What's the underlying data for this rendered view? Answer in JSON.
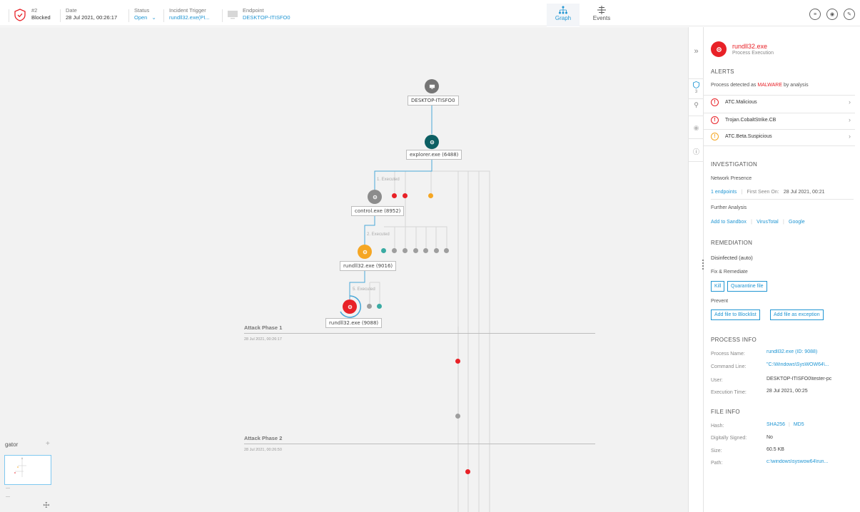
{
  "topbar": {
    "incident_no": "#2",
    "incident_status": "Blocked",
    "date_label": "Date",
    "date_value": "28 Jul 2021, 00:26:17",
    "status_label": "Status",
    "status_value": "Open",
    "trigger_label": "Incident Trigger",
    "trigger_value": "rundll32.exe(PI...",
    "endpoint_label": "Endpoint",
    "endpoint_value": "DESKTOP-ITISFO0",
    "tabs": [
      {
        "label": "Graph",
        "icon": "graph-icon",
        "active": true
      },
      {
        "label": "Events",
        "icon": "events-icon",
        "active": false
      }
    ],
    "actions": [
      "list-icon",
      "eye-icon",
      "edit-icon"
    ]
  },
  "graph": {
    "nodes": [
      {
        "label": "DESKTOP-ITISFO0",
        "icon": "monitor-icon",
        "color": "#757575"
      },
      {
        "label": "explorer.exe (6488)",
        "icon": "process-icon",
        "color": "#0d5f63"
      },
      {
        "label": "control.exe (8952)",
        "icon": "process-icon",
        "color": "#8c8c8c"
      },
      {
        "label": "rundll32.exe (9016)",
        "icon": "process-icon",
        "color": "#f5a623"
      },
      {
        "label": "rundll32.exe (9088)",
        "icon": "process-icon",
        "color": "#e82127"
      }
    ],
    "edges": [
      "1. Executed",
      "2. Executed",
      "5. Executed"
    ],
    "phases": [
      {
        "title": "Attack Phase 1",
        "date": "28 Jul 2021, 00:26:17"
      },
      {
        "title": "Attack Phase 2",
        "date": "28 Jul 2021, 00:26:50"
      }
    ],
    "colors": {
      "red": "#e82127",
      "orange": "#f5a623",
      "teal": "#3aaba3",
      "gray": "#9e9e9e",
      "edge": "#4aa8d8"
    }
  },
  "navigator": {
    "title": "gator",
    "plus": "+"
  },
  "strip": {
    "collapse": "»",
    "badge_count": "3"
  },
  "panel": {
    "process_name": "rundll32.exe",
    "process_subtitle": "Process Execution",
    "alerts_title": "ALERTS",
    "alerts_desc_prefix": "Process detected as",
    "alerts_desc_highlight": "MALWARE",
    "alerts_desc_suffix": "by analysis",
    "alerts": [
      {
        "name": "ATC.Malicious",
        "severity": "high"
      },
      {
        "name": "Trojan.CobaltStrike.CB",
        "severity": "high"
      },
      {
        "name": "ATC.Beta.Suspicious",
        "severity": "medium"
      }
    ],
    "investigation_title": "INVESTIGATION",
    "network_presence_label": "Network Presence",
    "endpoints_link": "1 endpoints",
    "first_seen_label": "First Seen On:",
    "first_seen_value": "28 Jul 2021, 00:21",
    "further_analysis_label": "Further Analysis",
    "analysis_links": [
      "Add to Sandbox",
      "VirusTotal",
      "Google"
    ],
    "remediation_title": "REMEDIATION",
    "remediation_status": "Disinfected (auto)",
    "fix_label": "Fix & Remediate",
    "fix_buttons": [
      "Kill",
      "Quarantine file"
    ],
    "prevent_label": "Prevent",
    "prevent_buttons": [
      "Add file to Blocklist",
      "Add file as exception"
    ],
    "process_info_title": "PROCESS INFO",
    "process_info": [
      {
        "key": "Process Name:",
        "value": "rundll32.exe (ID: 9088)",
        "link": true
      },
      {
        "key": "Command Line:",
        "value": "\"C:\\Windows\\SysWOW64\\...",
        "link": true
      },
      {
        "key": "User:",
        "value": "DESKTOP-ITISFO0\\tester-pc",
        "link": false
      },
      {
        "key": "Execution Time:",
        "value": "28 Jul 2021, 00:25",
        "link": false
      }
    ],
    "file_info_title": "FILE INFO",
    "hash_key": "Hash:",
    "hash_links": [
      "SHA256",
      "MD5"
    ],
    "file_info": [
      {
        "key": "Digitally Signed:",
        "value": "No",
        "link": false
      },
      {
        "key": "Size:",
        "value": "60.5 KB",
        "link": false
      },
      {
        "key": "Path:",
        "value": "c:\\windows\\syswow64\\run...",
        "link": true
      }
    ]
  }
}
